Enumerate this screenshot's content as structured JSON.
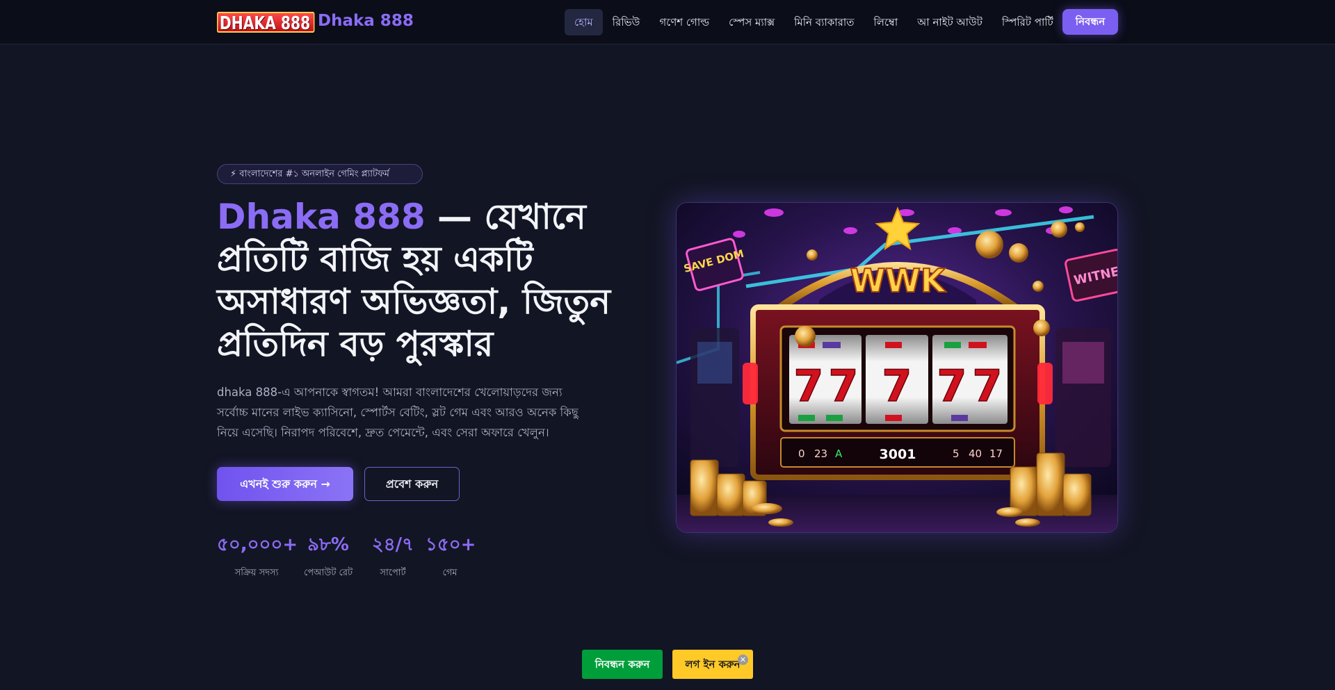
{
  "header": {
    "logo_badge": "DHAKA 888",
    "logo_text": "Dhaka 888",
    "nav": [
      {
        "label": "হোম",
        "active": true
      },
      {
        "label": "রিভিউ",
        "active": false
      },
      {
        "label": "গণেশ গোল্ড",
        "active": false
      },
      {
        "label": "স্পেস ম্যাক্স",
        "active": false
      },
      {
        "label": "মিনি ব্যাকারাত",
        "active": false
      },
      {
        "label": "লিম্বো",
        "active": false
      },
      {
        "label": "আ নাইট আউট",
        "active": false
      },
      {
        "label": "স্পিরিট পার্টি",
        "active": false
      }
    ],
    "cta": "নিবন্ধন"
  },
  "hero": {
    "badge": "⚡ বাংলাদেশের #১ অনলাইন গেমিং প্ল্যাটফর্ম",
    "title_brand": "Dhaka 888",
    "title_rest": " — যেখানে প্রতিটি বাজি হয় একটি অসাধারণ অভিজ্ঞতা, জিতুন প্রতিদিন বড় পুরস্কার",
    "description": "dhaka 888-এ আপনাকে স্বাগতম! আমরা বাংলাদেশের খেলোয়াড়দের জন্য সর্বোচ্চ মানের লাইভ ক্যাসিনো, স্পোর্টস বেটিং, স্লট গেম এবং আরও অনেক কিছু নিয়ে এসেছি। নিরাপদ পরিবেশে, দ্রুত পেমেন্টে, এবং সেরা অফারে খেলুন।",
    "primary_button": "এখনই শুরু করুন →",
    "secondary_button": "প্রবেশ করুন",
    "stats": [
      {
        "value": "৫০,০০০+",
        "label": "সক্রিয় সদস্য"
      },
      {
        "value": "৯৮%",
        "label": "পেআউট রেট"
      },
      {
        "value": "২৪/৭",
        "label": "সাপোর্ট"
      },
      {
        "value": "১৫০+",
        "label": "গেম"
      }
    ],
    "image": {
      "sign": "WWK",
      "reel_symbol": "7",
      "display_center": "3001",
      "display_left": [
        "0",
        "23",
        "A"
      ],
      "display_right": [
        "5",
        "40",
        "17"
      ],
      "neon_left": "SAVE DOM",
      "neon_right": "WITNE"
    }
  },
  "bottom_bar": {
    "register": "নিবন্ধন করুন",
    "login": "লগ ইন করুন",
    "close": "✕"
  }
}
